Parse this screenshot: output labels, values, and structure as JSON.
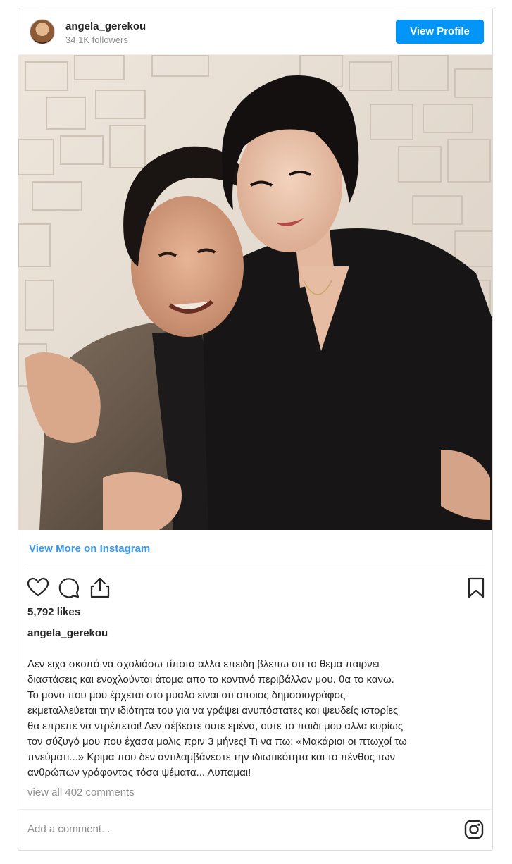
{
  "header": {
    "username": "angela_gerekou",
    "followers": "34.1K followers",
    "view_profile_label": "View Profile"
  },
  "post": {
    "view_more_label": "View More on Instagram",
    "likes": "5,792 likes",
    "caption_username": "angela_gerekou",
    "caption_lines": [
      "Δεν ειχα σκοπό να σχολιάσω τίποτα αλλα επειδη βλεπω οτι το θεμα παιρνει",
      "διαστάσεις και ενοχλούνται άτομα απο το κοντινό περιβάλλον μου, θα το κανω.",
      "Το μονο που μου έρχεται στο μυαλο ειναι οτι οποιος δημοσιογράφος",
      "εκμεταλλεύεται την ιδιότητα του για να γράψει ανυπόστατες και ψευδείς ιστορίες",
      "θα επρεπε να ντρέπεται! Δεν σέβεστε ουτε εμένα, ουτε το παιδι μου αλλα κυρίως",
      "τον σύζυγό μου που έχασα μολις πριν 3 μήνες! Τι να πω; «Μακάριοι οι πτωχοί τω",
      "πνεύματι...» Κριμα που δεν αντιλαμβάνεστε την ιδιωτικότητα και το πένθος των",
      "ανθρώπων γράφοντας τόσα ψέματα... Λυπαμαι!"
    ],
    "comments_link": "view all 402 comments",
    "add_comment_placeholder": "Add a comment..."
  },
  "icons": {
    "like": "heart-icon",
    "comment": "comment-icon",
    "share": "share-icon",
    "save": "bookmark-icon",
    "instagram": "instagram-icon"
  },
  "colors": {
    "accent": "#0095f6",
    "link": "#3897f0",
    "text": "#262626",
    "muted": "#8e8e8e",
    "border": "#dbdbdb"
  }
}
